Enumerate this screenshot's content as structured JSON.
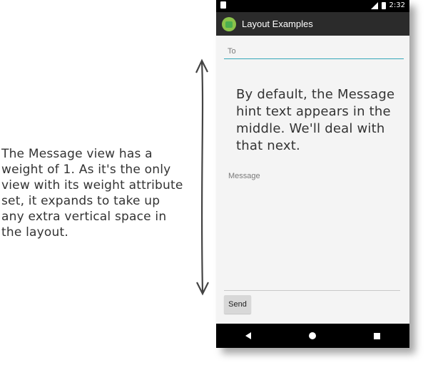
{
  "status_bar": {
    "time": "2:32"
  },
  "app_bar": {
    "title": "Layout Examples"
  },
  "form": {
    "to_hint": "To",
    "message_hint": "Message",
    "send_label": "Send"
  },
  "annotations": {
    "left_note": "The Message view has a weight of 1. As it's the only view with its weight attribute set, it expands to take up any extra vertical space in the layout.",
    "right_note": "By default, the Message hint text appears in the middle. We'll deal with that next."
  },
  "colors": {
    "accent": "#35a7b8",
    "app_bar": "#2b2b2b",
    "content_bg": "#f4f4f4"
  },
  "icons": [
    "android-app-icon",
    "signal-icon",
    "battery-icon",
    "back-icon",
    "home-icon",
    "recents-icon"
  ]
}
